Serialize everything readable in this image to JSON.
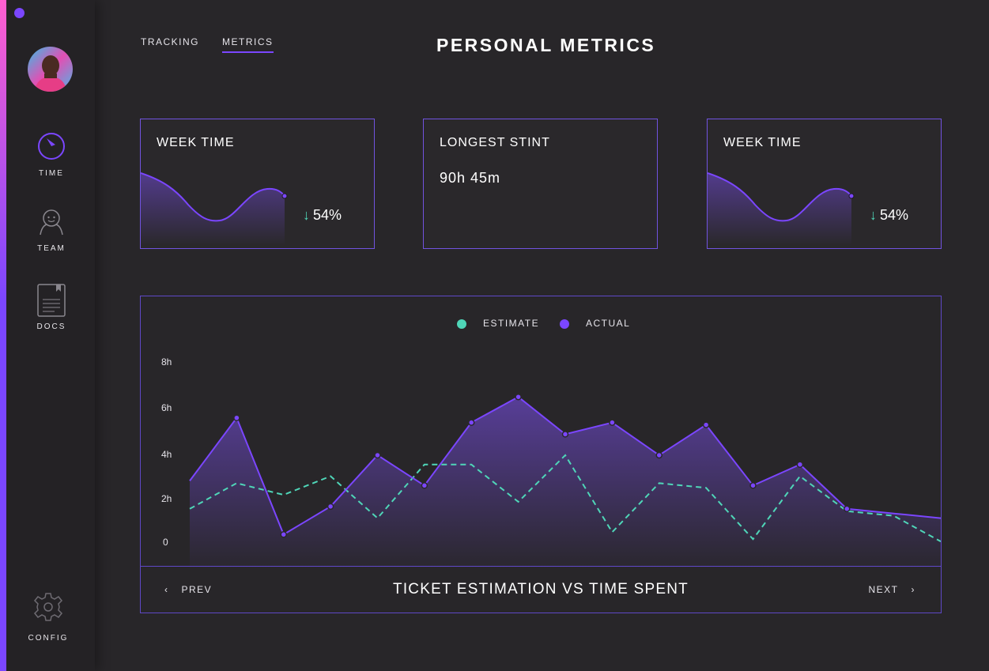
{
  "sidebar": {
    "items": [
      {
        "label": "TIME",
        "icon": "timer-icon"
      },
      {
        "label": "TEAM",
        "icon": "team-icon"
      },
      {
        "label": "DOCS",
        "icon": "docs-icon"
      }
    ],
    "config_label": "CONFIG",
    "accent_color": "#7b46ff",
    "gradient_top": "#ff5fcf"
  },
  "top_nav": {
    "tracking": "TRACKING",
    "metrics": "METRICS",
    "active": "METRICS"
  },
  "page_title": "PERSONAL METRICS",
  "cards": [
    {
      "title": "WEEK TIME",
      "delta": "54%",
      "direction": "down"
    },
    {
      "title": "LONGEST STINT",
      "value": "90h 45m"
    },
    {
      "title": "WEEK TIME",
      "delta": "54%",
      "direction": "down"
    }
  ],
  "chart": {
    "title": "TICKET ESTIMATION VS TIME SPENT",
    "prev_label": "PREV",
    "next_label": "NEXT",
    "legend": [
      {
        "label": "ESTIMATE",
        "color": "#4fd6b8"
      },
      {
        "label": "ACTUAL",
        "color": "#7b46ff"
      }
    ]
  },
  "chart_data": {
    "type": "line",
    "y_ticks": [
      "8h",
      "6h",
      "4h",
      "2h",
      "0"
    ],
    "ylim": [
      0,
      8
    ],
    "series": [
      {
        "name": "ESTIMATE",
        "style": "dashed",
        "color": "#4fd6b8",
        "values": [
          1.6,
          2.7,
          2.2,
          3.0,
          1.2,
          3.5,
          3.5,
          1.9,
          3.9,
          0.6,
          2.7,
          2.5,
          0.3,
          3.0,
          1.5,
          1.3,
          0.2
        ]
      },
      {
        "name": "ACTUAL",
        "style": "solid",
        "color": "#7b46ff",
        "values": [
          2.8,
          5.5,
          0.5,
          1.7,
          3.9,
          2.6,
          5.3,
          6.4,
          4.8,
          5.3,
          3.9,
          5.2,
          2.6,
          3.5,
          1.6,
          1.4,
          1.2
        ]
      }
    ]
  }
}
